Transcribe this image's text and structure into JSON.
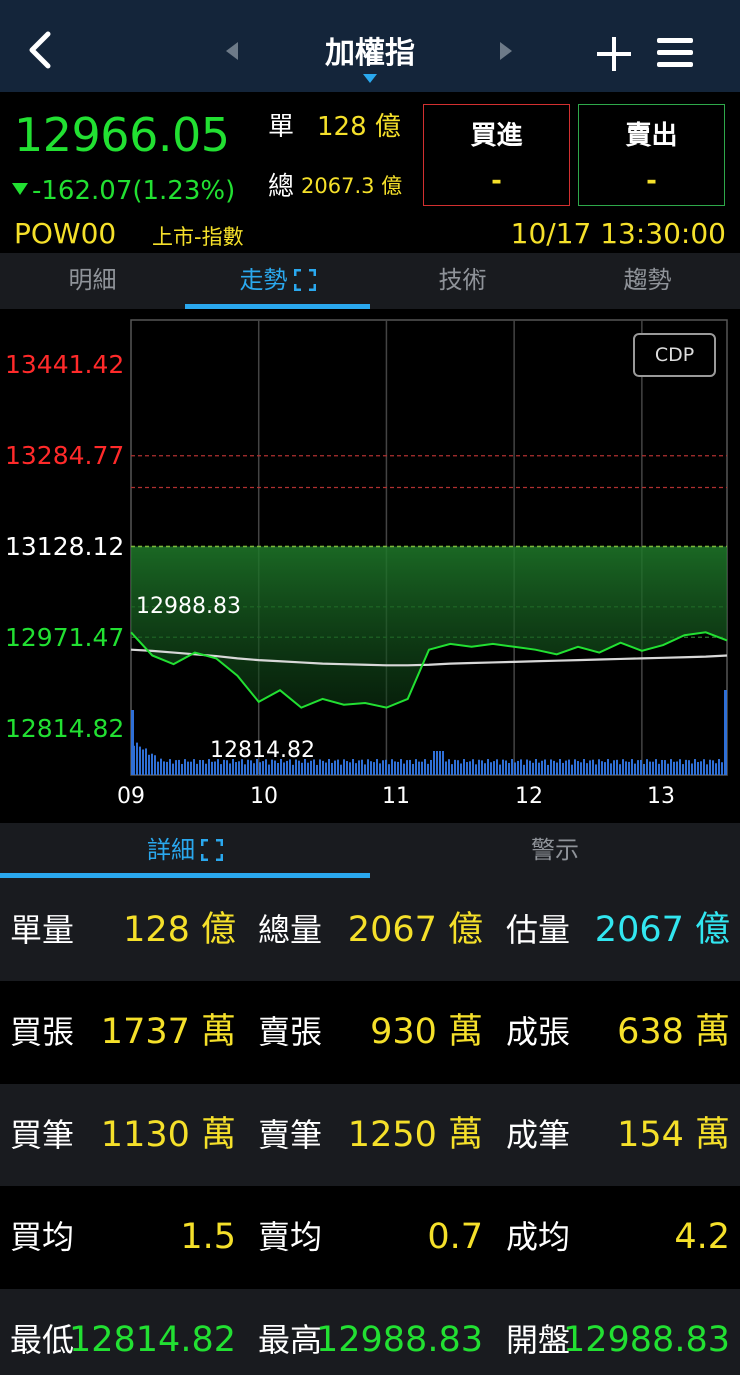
{
  "nav": {
    "title": "加權指",
    "back_icon": "chevron-left-icon",
    "add_icon": "plus-icon",
    "menu_icon": "hamburger-menu-icon"
  },
  "quote": {
    "price": "12966.05",
    "change": "-162.07(1.23%)",
    "single_label": "單",
    "single_value": "128 億",
    "total_label": "總",
    "total_value": "2067.3 億",
    "buy_label": "買進",
    "buy_value": "-",
    "sell_label": "賣出",
    "sell_value": "-",
    "code": "POW00",
    "market": "上市-指數",
    "datetime": "10/17 13:30:00"
  },
  "tabs": [
    {
      "label": "明細"
    },
    {
      "label": "走勢"
    },
    {
      "label": "技術"
    },
    {
      "label": "趨勢"
    }
  ],
  "chart": {
    "cdp_label": "CDP",
    "high_label": "12988.83",
    "low_label": "12814.82",
    "y_ticks": [
      {
        "label": "13441.42",
        "color": "#ff2a2a"
      },
      {
        "label": "13284.77",
        "color": "#ff2a2a"
      },
      {
        "label": "13128.12",
        "color": "#ffffff"
      },
      {
        "label": "12971.47",
        "color": "#22e032"
      },
      {
        "label": "12814.82",
        "color": "#22e032"
      }
    ],
    "x_ticks": [
      "09",
      "10",
      "11",
      "12",
      "13"
    ]
  },
  "chart_data": {
    "type": "line",
    "title": "",
    "xlabel": "",
    "ylabel": "",
    "ylim": [
      12814.82,
      13441.42
    ],
    "reference": 13128.12,
    "x": [
      "09:00",
      "09:10",
      "09:20",
      "09:30",
      "09:40",
      "09:50",
      "10:00",
      "10:10",
      "10:20",
      "10:30",
      "10:40",
      "10:50",
      "11:00",
      "11:10",
      "11:15",
      "11:20",
      "11:30",
      "11:40",
      "11:50",
      "12:00",
      "12:10",
      "12:20",
      "12:30",
      "12:40",
      "12:50",
      "13:00",
      "13:10",
      "13:20",
      "13:30"
    ],
    "series": [
      {
        "values": [
          12980,
          12940,
          12925,
          12945,
          12935,
          12905,
          12860,
          12880,
          12850,
          12865,
          12855,
          12858,
          12850,
          12865,
          12950,
          12960,
          12955,
          12960,
          12955,
          12950,
          12942,
          12955,
          12945,
          12962,
          12948,
          12958,
          12975,
          12980,
          12966
        ],
        "color": "#22e032"
      },
      {
        "values": [
          12950,
          12948,
          12945,
          12942,
          12939,
          12935,
          12932,
          12930,
          12928,
          12926,
          12925,
          12924,
          12923,
          12923,
          12924,
          12926,
          12927,
          12928,
          12929,
          12930,
          12931,
          12932,
          12933,
          12934,
          12935,
          12936,
          12937,
          12938,
          12940
        ],
        "color": "#d8d8d8"
      }
    ],
    "grid": true,
    "cdp_levels": [
      13284.77,
      13230.0,
      13128.12,
      13024.0,
      12971.47
    ]
  },
  "detail_tabs": [
    {
      "label": "詳細"
    },
    {
      "label": "警示"
    }
  ],
  "stats": [
    [
      {
        "label": "單量",
        "value": "128 億",
        "color": "yellow"
      },
      {
        "label": "總量",
        "value": "2067 億",
        "color": "yellow"
      },
      {
        "label": "估量",
        "value": "2067 億",
        "color": "cyan"
      }
    ],
    [
      {
        "label": "買張",
        "value": "1737 萬",
        "color": "yellow"
      },
      {
        "label": "賣張",
        "value": "930 萬",
        "color": "yellow"
      },
      {
        "label": "成張",
        "value": "638 萬",
        "color": "yellow"
      }
    ],
    [
      {
        "label": "買筆",
        "value": "1130 萬",
        "color": "yellow"
      },
      {
        "label": "賣筆",
        "value": "1250 萬",
        "color": "yellow"
      },
      {
        "label": "成筆",
        "value": "154 萬",
        "color": "yellow"
      }
    ],
    [
      {
        "label": "買均",
        "value": "1.5",
        "color": "yellow"
      },
      {
        "label": "賣均",
        "value": "0.7",
        "color": "yellow"
      },
      {
        "label": "成均",
        "value": "4.2",
        "color": "yellow"
      }
    ],
    [
      {
        "label": "最低",
        "value": "12814.82",
        "color": "green"
      },
      {
        "label": "最高",
        "value": "12988.83",
        "color": "green"
      },
      {
        "label": "開盤",
        "value": "12988.83",
        "color": "green"
      }
    ]
  ]
}
